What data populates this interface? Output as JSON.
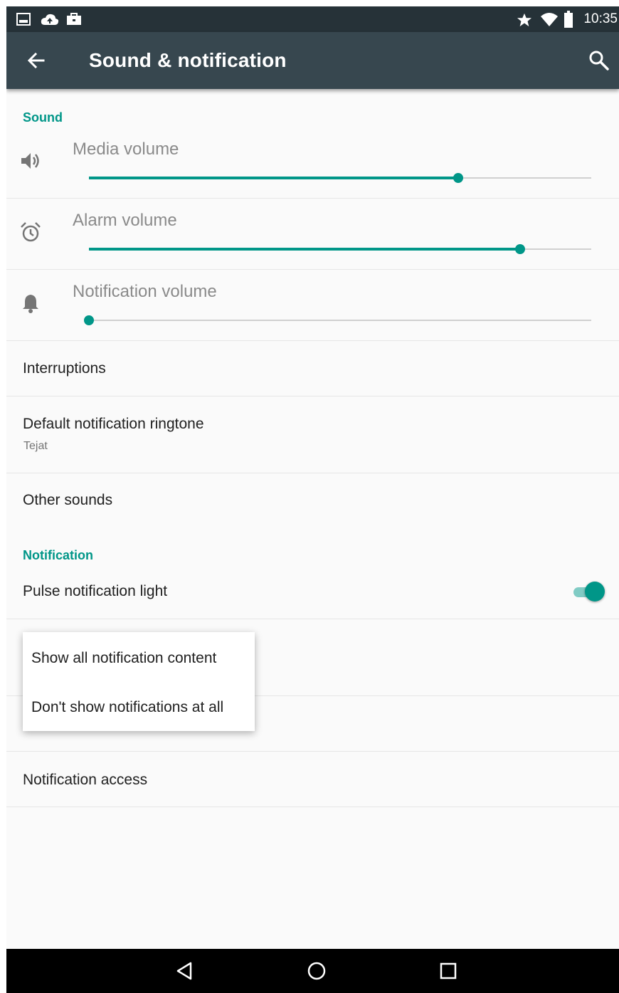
{
  "status_bar": {
    "time": "10:35",
    "left_icons": [
      "screenshot-icon",
      "cloud-upload-icon",
      "briefcase-icon"
    ],
    "right_icons": [
      "star-icon",
      "wifi-icon",
      "battery-icon"
    ]
  },
  "toolbar": {
    "title": "Sound & notification",
    "back_icon": "arrow-back-icon",
    "search_icon": "search-icon"
  },
  "sections": {
    "sound_header": "Sound",
    "notification_header": "Notification"
  },
  "volumes": [
    {
      "label": "Media volume",
      "icon": "volume-icon",
      "level": 0.735
    },
    {
      "label": "Alarm volume",
      "icon": "alarm-icon",
      "level": 0.858
    },
    {
      "label": "Notification volume",
      "icon": "bell-icon",
      "level": 0.0
    }
  ],
  "prefs": {
    "interruptions": "Interruptions",
    "ringtone_title": "Default notification ringtone",
    "ringtone_summary": "Tejat",
    "other_sounds": "Other sounds",
    "pulse_light": "Pulse notification light",
    "pulse_light_on": true,
    "notification_access": "Notification access"
  },
  "popup": {
    "options": [
      "Show all notification content",
      "Don't show notifications at all"
    ]
  },
  "colors": {
    "accent": "#009688",
    "toolbar": "#37474f",
    "status_bar": "#263238",
    "nav_bar": "#000000"
  },
  "nav_bar": {
    "icons": [
      "back-triangle-icon",
      "home-circle-icon",
      "recents-square-icon"
    ]
  }
}
